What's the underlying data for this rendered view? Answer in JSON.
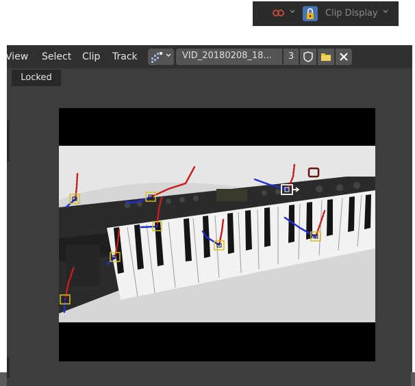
{
  "top_bar": {
    "overlay_icon": "overlay-rings-icon",
    "lock_icon": "padlock-icon",
    "label": "Clip Display",
    "dropdown_icon": "chevron-down-icon"
  },
  "header": {
    "menus": [
      {
        "label": "View"
      },
      {
        "label": "Select"
      },
      {
        "label": "Clip"
      },
      {
        "label": "Track"
      }
    ],
    "clip_type_icon": "clip-editor-icon",
    "clip_name": "VID_20180208_18...",
    "users_count": "3",
    "icons": {
      "fake_user": "shield-icon",
      "open": "folder-icon",
      "close": "close-icon"
    }
  },
  "viewport": {
    "locked_label": "Locked",
    "colors": {
      "path_before": "#c81e1e",
      "path_after": "#1e2ed2",
      "marker": "#d4c020",
      "selected_marker": "#ffffff"
    }
  }
}
